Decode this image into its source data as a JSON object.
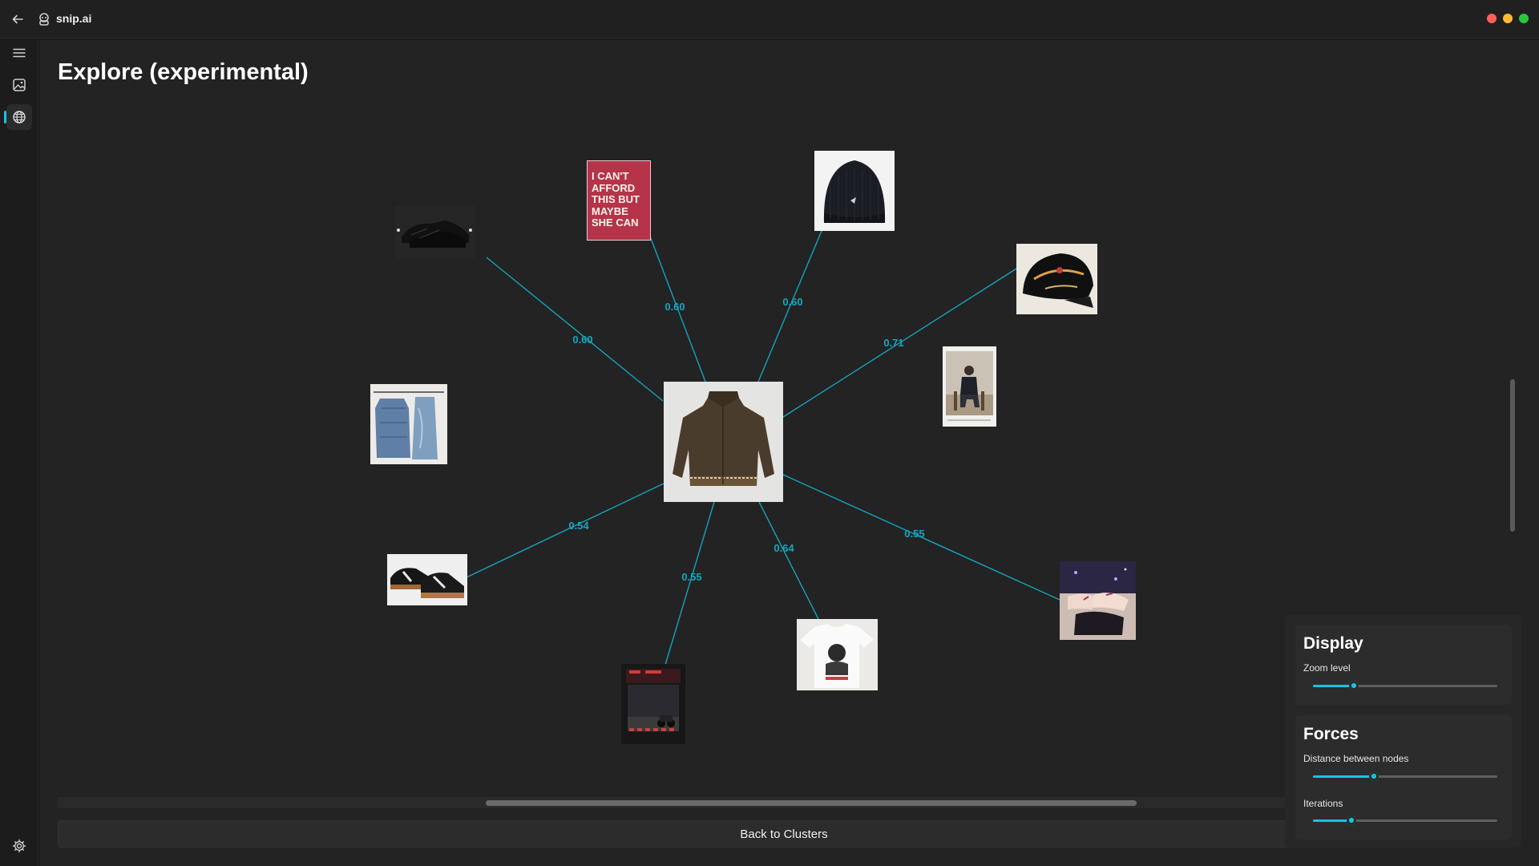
{
  "app": {
    "name": "snip.ai"
  },
  "colors": {
    "accent": "#18c3e0",
    "edge": "#14a3bd",
    "close": "#ff5f57",
    "minimize": "#febc2e",
    "maximize": "#28c840"
  },
  "sidebar": {
    "items": [
      {
        "icon": "menu-icon"
      },
      {
        "icon": "image-icon"
      },
      {
        "icon": "globe-icon",
        "active": true
      }
    ],
    "footer_icon": "gear-icon"
  },
  "page": {
    "title": "Explore (experimental)"
  },
  "graph": {
    "center": {
      "id": "center",
      "description": "brown zip jacket"
    },
    "nodes": [
      {
        "id": "sneakers-black",
        "description": "black sneakers"
      },
      {
        "id": "poster",
        "poster_text": [
          "I CAN'T",
          "AFFORD",
          "THIS BUT",
          "MAYBE",
          "SHE CAN"
        ]
      },
      {
        "id": "beanie",
        "description": "black beanie"
      },
      {
        "id": "cap",
        "description": "black embroidered cap"
      },
      {
        "id": "person-chair",
        "description": "photo of person on chair"
      },
      {
        "id": "denim-jacket",
        "description": "blue denim jackets"
      },
      {
        "id": "sneakers-gum",
        "description": "black sneakers gum sole"
      },
      {
        "id": "street-photo",
        "description": "street photograph"
      },
      {
        "id": "tshirt",
        "description": "white graphic t-shirt"
      },
      {
        "id": "illustration",
        "description": "illustrated hands"
      }
    ],
    "edges": [
      {
        "to": "sneakers-black",
        "label": "0.60"
      },
      {
        "to": "poster",
        "label": "0.60"
      },
      {
        "to": "beanie",
        "label": "0.60"
      },
      {
        "to": "cap",
        "label": "0.71"
      },
      {
        "to": "sneakers-gum",
        "label": "0.54"
      },
      {
        "to": "street-photo",
        "label": "0.55"
      },
      {
        "to": "tshirt",
        "label": "0.64"
      },
      {
        "to": "illustration",
        "label": "0.55"
      }
    ]
  },
  "buttons": {
    "back_to_clusters": "Back to Clusters"
  },
  "panel": {
    "display": {
      "title": "Display",
      "zoom": {
        "label": "Zoom level",
        "value_fraction": 0.22
      }
    },
    "forces": {
      "title": "Forces",
      "distance": {
        "label": "Distance between nodes",
        "value_fraction": 0.33
      },
      "iterations": {
        "label": "Iterations",
        "value_fraction": 0.21
      }
    }
  }
}
